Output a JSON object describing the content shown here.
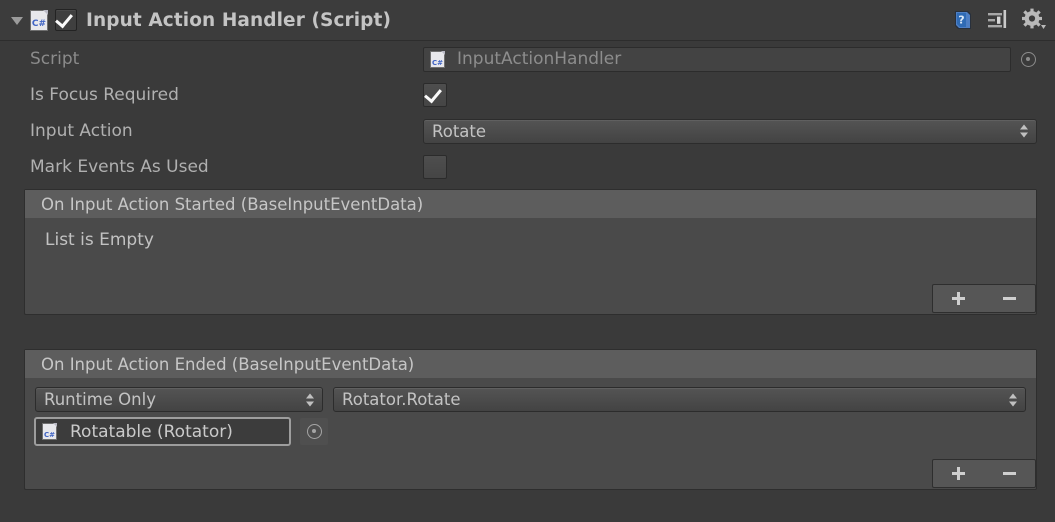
{
  "component": {
    "title": "Input Action Handler (Script)",
    "enabled_checkbox": "checked",
    "script_type_icon": "csharp-script-icon",
    "foldout_state": "expanded",
    "header_icons": [
      {
        "name": "help-icon",
        "glyph": "?"
      },
      {
        "name": "preset-icon",
        "glyph": "sliders"
      },
      {
        "name": "gear-icon",
        "glyph": "gear"
      }
    ]
  },
  "properties": {
    "script": {
      "label": "Script",
      "value": "InputActionHandler",
      "icon": "csharp-script-icon",
      "picker": "object-picker-icon"
    },
    "is_focus_required": {
      "label": "Is Focus Required",
      "value": "checked"
    },
    "input_action": {
      "label": "Input Action",
      "value": "Rotate",
      "options": [
        "Rotate"
      ]
    },
    "mark_events_as_used": {
      "label": "Mark Events As Used",
      "value": "unchecked"
    }
  },
  "events": {
    "started": {
      "title": "On Input Action Started (BaseInputEventData)",
      "empty_text": "List is Empty",
      "add_label": "+",
      "remove_label": "−"
    },
    "ended": {
      "title": "On Input Action Ended (BaseInputEventData)",
      "add_label": "+",
      "remove_label": "−",
      "entries": [
        {
          "mode": "Runtime Only",
          "function": "Rotator.Rotate",
          "target": "Rotatable (Rotator)",
          "target_icon": "csharp-script-icon"
        }
      ]
    }
  },
  "cs_glyph": "C#",
  "colors": {
    "background": "#3a3a3a",
    "header": "#3c3c3c",
    "list_body": "#4a4a4a",
    "section_header": "#5d5d5d",
    "text": "#b4b4b4",
    "cs_blue": "#3f63c4"
  }
}
